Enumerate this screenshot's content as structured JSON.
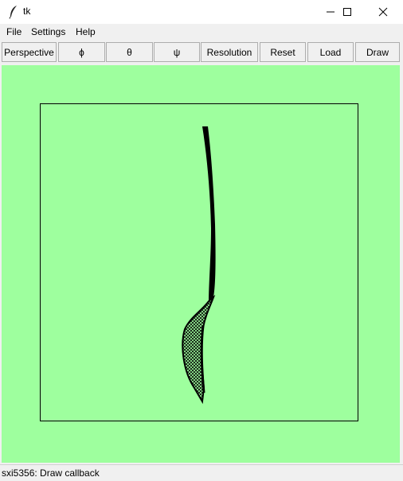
{
  "window": {
    "title": "tk"
  },
  "window_controls": [
    "minimize-icon",
    "maximize-icon",
    "close-icon"
  ],
  "menu": [
    "File",
    "Settings",
    "Help"
  ],
  "toolbar": [
    "Perspective",
    "ϕ",
    "θ",
    "ψ",
    "Resolution",
    "Reset",
    "Load",
    "Draw"
  ],
  "canvas": {
    "background": "#9eff9e",
    "frame_color": "#000000",
    "drawing_color": "#000000"
  },
  "status": {
    "text": "sxi5356: Draw callback"
  }
}
